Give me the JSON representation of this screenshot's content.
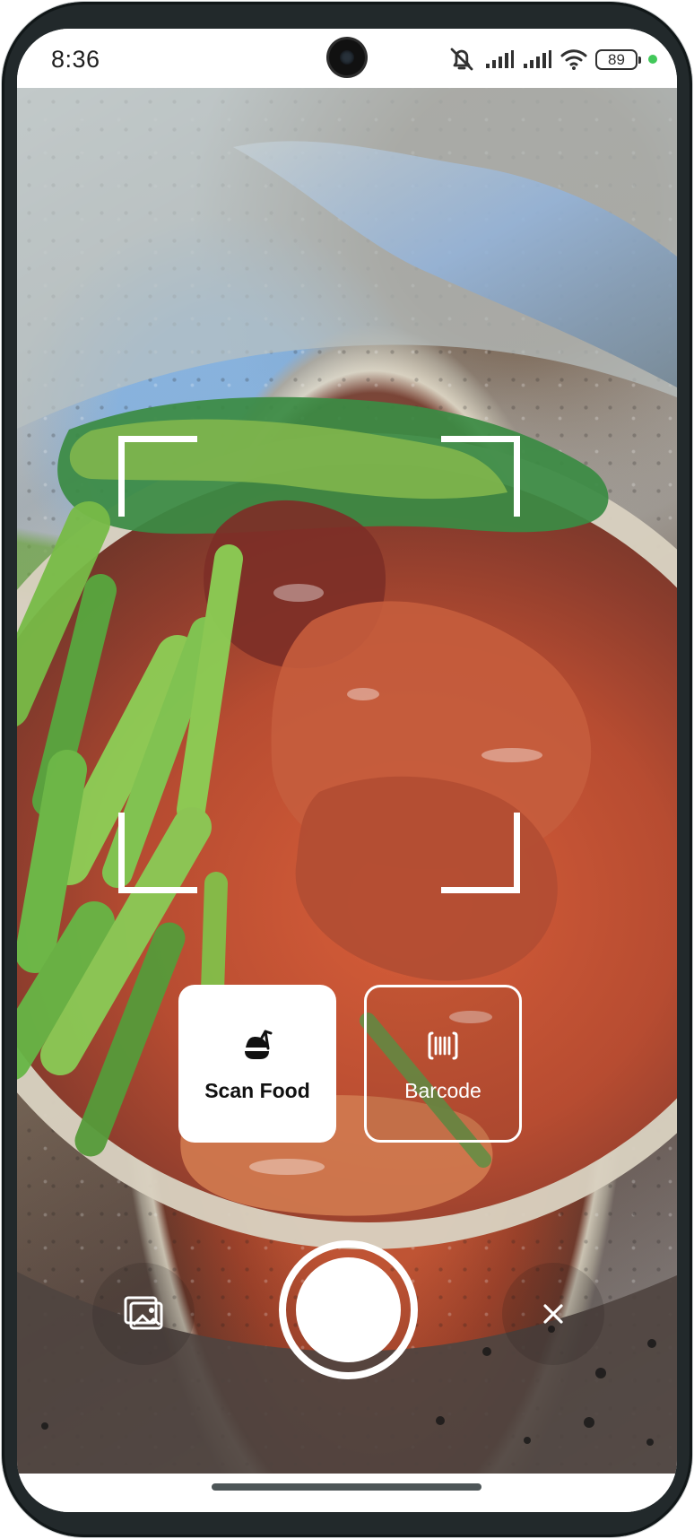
{
  "status_bar": {
    "time": "8:36",
    "battery": "89",
    "icons": [
      "bell-muted-icon",
      "signal-icon",
      "signal-icon",
      "wifi-icon",
      "battery-icon",
      "privacy-indicator-dot"
    ]
  },
  "camera": {
    "scan_frame_icons": [
      "top-left-corner",
      "top-right-corner",
      "bottom-left-corner",
      "bottom-right-corner"
    ],
    "modes": [
      {
        "label": "Scan Food",
        "icon": "food-scan-icon",
        "selected": true
      },
      {
        "label": "Barcode",
        "icon": "barcode-icon",
        "selected": false
      }
    ],
    "controls": {
      "gallery_icon": "gallery-icon",
      "shutter_icon": "shutter-button",
      "close_icon": "close-icon"
    }
  },
  "colors": {
    "selected_mode_background": "#ffffff",
    "selected_mode_text": "#111111",
    "unselected_mode_border": "#ffffff",
    "control_icon": "#ffffff",
    "privacy_dot": "#42c85a",
    "device_frame": "#22292b"
  }
}
